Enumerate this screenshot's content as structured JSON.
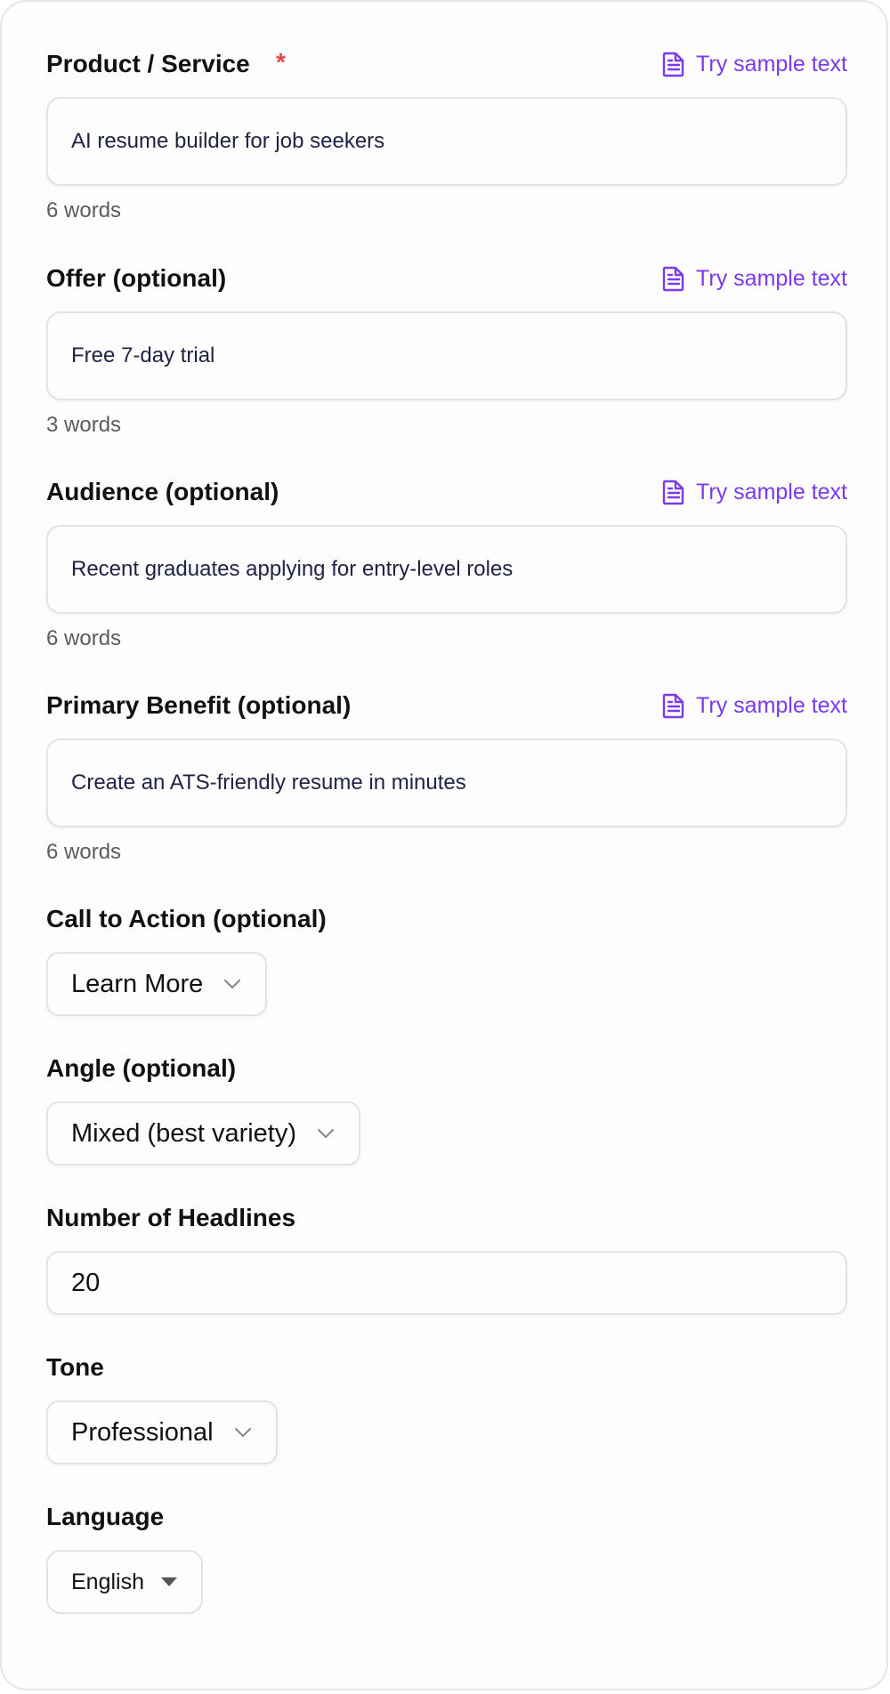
{
  "fields": {
    "product": {
      "label": "Product / Service",
      "required_mark": "*",
      "sample_link": "Try sample text",
      "value": "AI resume builder for job seekers",
      "word_count": "6 words"
    },
    "offer": {
      "label": "Offer (optional)",
      "sample_link": "Try sample text",
      "value": "Free 7-day trial",
      "word_count": "3 words"
    },
    "audience": {
      "label": "Audience (optional)",
      "sample_link": "Try sample text",
      "value": "Recent graduates applying for entry-level roles",
      "word_count": "6 words"
    },
    "benefit": {
      "label": "Primary Benefit (optional)",
      "sample_link": "Try sample text",
      "value": "Create an ATS-friendly resume in minutes",
      "word_count": "6 words"
    },
    "cta": {
      "label": "Call to Action (optional)",
      "selected": "Learn More"
    },
    "angle": {
      "label": "Angle (optional)",
      "selected": "Mixed (best variety)"
    },
    "headlines": {
      "label": "Number of Headlines",
      "value": "20"
    },
    "tone": {
      "label": "Tone",
      "selected": "Professional"
    },
    "language": {
      "label": "Language",
      "selected": "English"
    }
  },
  "colors": {
    "accent": "#7c3aed",
    "required": "#e0454b",
    "input_text": "#1f2245",
    "muted_text": "#5b5b60",
    "border": "#e1e3e8"
  },
  "icons": {
    "sample_link": "document-icon",
    "select": "chevron-down-icon",
    "language_select": "caret-down-icon"
  }
}
